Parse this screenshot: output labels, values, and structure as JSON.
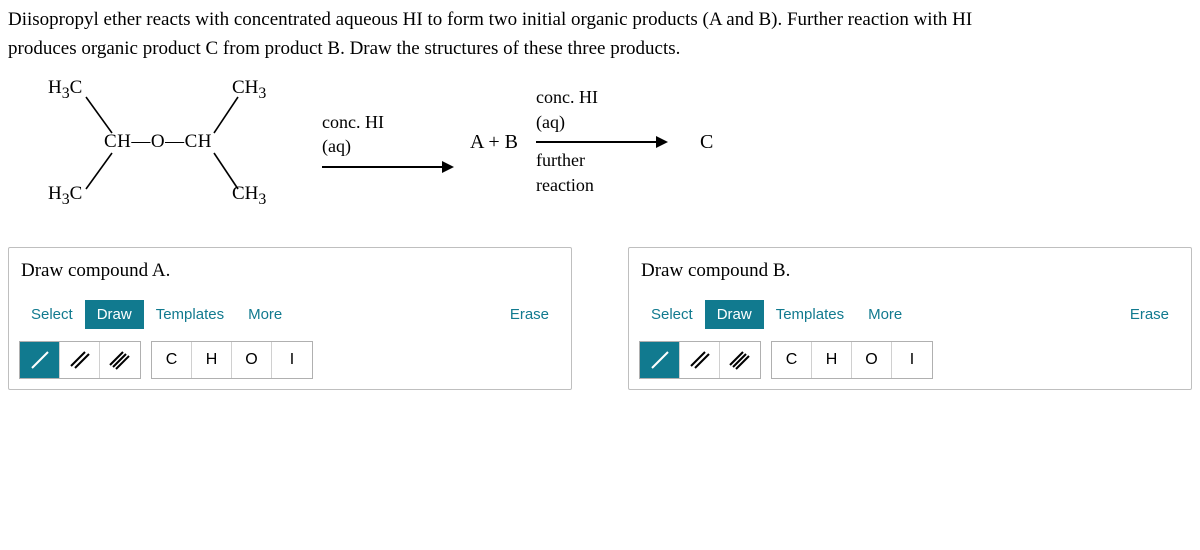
{
  "question": {
    "line1": "Diisopropyl ether reacts with concentrated aqueous HI to form two initial organic products (A and B). Further reaction with HI",
    "line2": "produces organic product C from product B. Draw the structures of these three products."
  },
  "reaction": {
    "mol": {
      "ch3_tl": "H<sub>3</sub>C",
      "ch3_tr": "CH<sub>3</sub>",
      "center": "CH—O—CH",
      "ch3_bl": "H<sub>3</sub>C",
      "ch3_br": "CH<sub>3</sub>"
    },
    "step1_top": "conc. HI",
    "step1_bot": "(aq)",
    "products1": "A + B",
    "step2_top": "conc. HI",
    "step2_bot": "(aq)",
    "step2_below1": "further",
    "step2_below2": "reaction",
    "products2": "C"
  },
  "panels": [
    {
      "title": "Draw compound A.",
      "tabs": [
        "Select",
        "Draw",
        "Templates",
        "More"
      ],
      "active_tab": 1,
      "erase": "Erase",
      "atoms": [
        "C",
        "H",
        "O",
        "I"
      ]
    },
    {
      "title": "Draw compound B.",
      "tabs": [
        "Select",
        "Draw",
        "Templates",
        "More"
      ],
      "active_tab": 1,
      "erase": "Erase",
      "atoms": [
        "C",
        "H",
        "O",
        "I"
      ]
    }
  ]
}
